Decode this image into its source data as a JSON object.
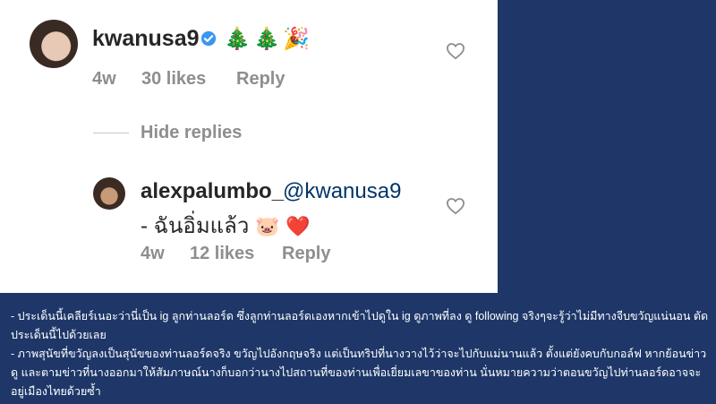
{
  "comment": {
    "username": "kwanusa9",
    "emoji": [
      "🎄",
      "🎄",
      "🎉"
    ],
    "time": "4w",
    "likes": "30 likes",
    "reply_label": "Reply"
  },
  "hide_replies": "Hide replies",
  "reply": {
    "username": "alexpalumbo_",
    "mention": "@kwanusa9",
    "text": "- ฉันอิ่มแล้ว",
    "emoji": [
      "🐷",
      "❤️"
    ],
    "time": "4w",
    "likes": "12 likes",
    "reply_label": "Reply"
  },
  "caption": {
    "line1": "- ประเด็นนี้เคลียร์เนอะว่านี่เป็น ig ลูกท่านลอร์ด ซึ่งลูกท่านลอร์ดเองหากเข้าไปดูใน ig ดูภาพที่ลง ดู following จริงๆจะรู้ว่าไม่มีทางจีบขวัญแน่นอน ตัดประเด็นนี้ไปด้วยเลย",
    "line2": "- ภาพสุนัขที่ขวัญลงเป็นสุนัขของท่านลอร์ดจริง ขวัญไปอังกฤษจริง แต่เป็นทริปที่นางวางไว้ว่าจะไปกับแม่นานแล้ว ตั้งแต่ยังคบกับกอล์ฟ หากย้อนข่าวดู และตามข่าวที่นางออกมาให้สัมภาษณ์นางก็บอกว่านางไปสถานที่ของท่านเพื่อเยี่ยมเลขาของท่าน นั่นหมายความว่าตอนขวัญไปท่านลอร์ดอาจจะอยู่เมืองไทยด้วยซ้ำ"
  },
  "colors": {
    "background": "#1e3768",
    "verified": "#3897f0",
    "mention": "#003569",
    "muted": "#8e8e8e"
  }
}
